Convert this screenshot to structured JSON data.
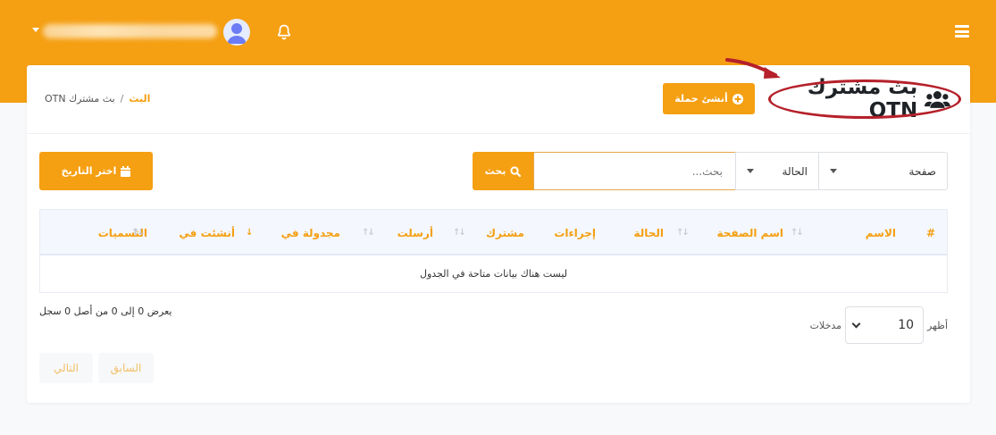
{
  "header": {
    "menu_icon": "hamburger-icon",
    "notifications_icon": "bell-icon",
    "avatar_icon": "user-avatar-icon"
  },
  "page": {
    "title": "بث مشترك OTN",
    "title_icon": "users-icon",
    "create_button": "أنشئ حملة",
    "breadcrumb": {
      "home": "البث",
      "separator": "/",
      "current": "بث مشترك OTN"
    }
  },
  "filters": {
    "page_select": "صفحة",
    "status_select": "الحالة",
    "search_placeholder": "بحث...",
    "search_button": "بحث",
    "date_button": "اختر التاريخ"
  },
  "table": {
    "columns": [
      "#",
      "الاسم",
      "اسم الصفحة",
      "الحالة",
      "إجراءات",
      "مشترك",
      "أرسلت",
      "مجدولة في",
      "أنشئت في",
      "التسميات"
    ],
    "empty_message": "ليست هناك بيانات متاحة في الجدول",
    "info": "يعرض 0 إلى 0 من أصل 0 سجل",
    "length_prefix": "أظهر",
    "length_value": "10",
    "length_suffix": "مدخلات",
    "prev_button": "السابق",
    "next_button": "التالي"
  },
  "colors": {
    "accent": "#f59f12",
    "highlight_ring": "#b5202a"
  }
}
